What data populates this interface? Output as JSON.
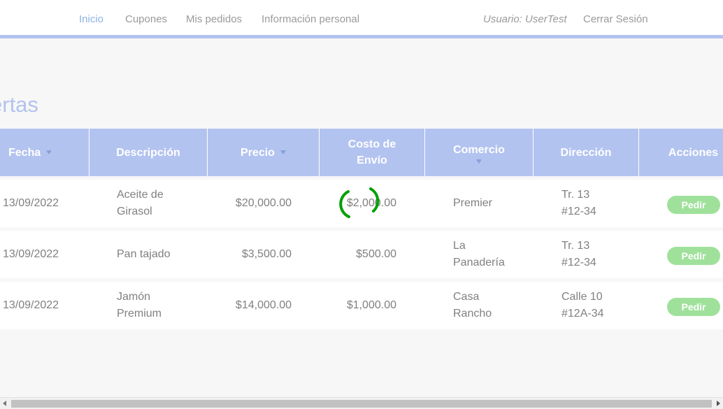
{
  "nav": {
    "inicio": "Inicio",
    "cupones": "Cupones",
    "mis_pedidos": "Mis pedidos",
    "info_personal": "Información personal",
    "usuario": "Usuario: UserTest",
    "cerrar_sesion": "Cerrar Sesión"
  },
  "page": {
    "title": "ertas"
  },
  "table": {
    "headers": {
      "fecha": "Fecha",
      "descripcion": "Descripción",
      "precio": "Precio",
      "costo_envio_1": "Costo de",
      "costo_envio_2": "Envío",
      "comercio": "Comercio",
      "direccion": "Dirección",
      "acciones": "Acciones"
    },
    "rows": [
      {
        "fecha": "13/09/2022",
        "desc_1": "Aceite de",
        "desc_2": "Girasol",
        "precio": "$20,000.00",
        "envio": "$2,000.00",
        "comercio_1": "Premier",
        "comercio_2": "",
        "dir_1": "Tr. 13",
        "dir_2": "#12-34",
        "accion": "Pedir"
      },
      {
        "fecha": "13/09/2022",
        "desc_1": "Pan tajado",
        "desc_2": "",
        "precio": "$3,500.00",
        "envio": "$500.00",
        "comercio_1": "La",
        "comercio_2": "Panadería",
        "dir_1": "Tr. 13",
        "dir_2": "#12-34",
        "accion": "Pedir"
      },
      {
        "fecha": "13/09/2022",
        "desc_1": "Jamón",
        "desc_2": "Premium",
        "precio": "$14,000.00",
        "envio": "$1,000.00",
        "comercio_1": "Casa",
        "comercio_2": "Rancho",
        "dir_1": "Calle 10",
        "dir_2": "#12A-34",
        "accion": "Pedir"
      }
    ]
  },
  "colors": {
    "accent": "#b3c3f0",
    "active_nav": "#8fb2e8",
    "button": "#9fe19b",
    "spinner": "#00a000"
  },
  "icons": {
    "sort": "sort-caret-down-icon",
    "spinner": "loading-spinner-icon"
  }
}
